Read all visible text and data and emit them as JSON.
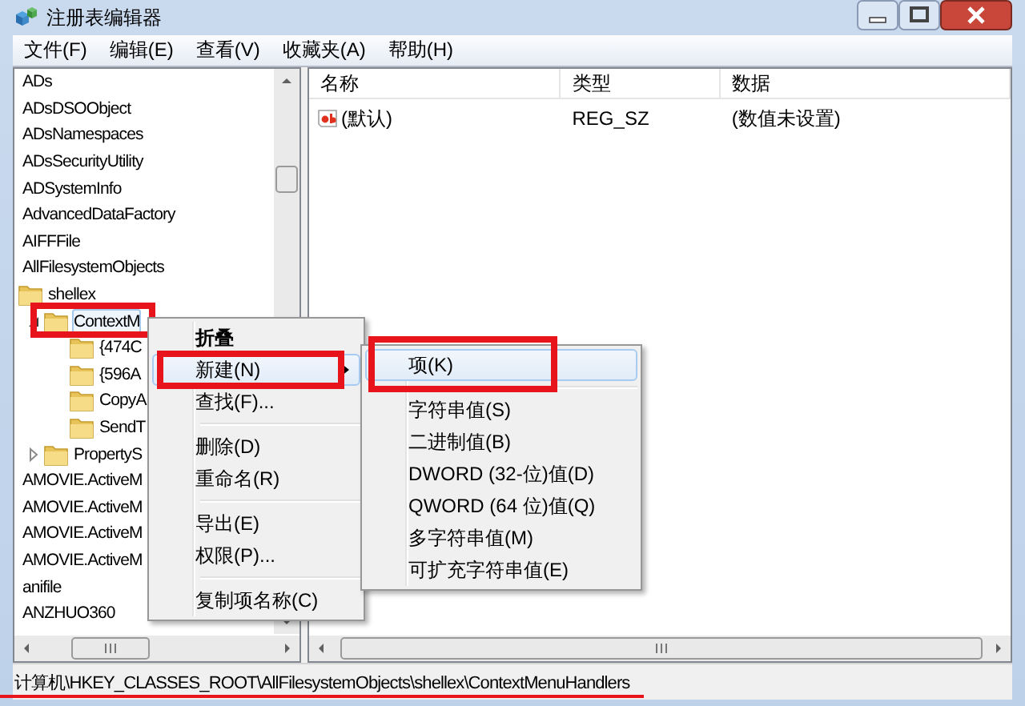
{
  "window": {
    "title": "注册表编辑器"
  },
  "menu_bar": [
    "文件(F)",
    "编辑(E)",
    "查看(V)",
    "收藏夹(A)",
    "帮助(H)"
  ],
  "tree": [
    {
      "label": "ADs",
      "selected": false
    },
    {
      "label": "ADsDSOObject",
      "selected": false
    },
    {
      "label": "ADsNamespaces",
      "selected": false
    },
    {
      "label": "ADsSecurityUtility",
      "selected": false
    },
    {
      "label": "ADSystemInfo",
      "selected": false
    },
    {
      "label": "AdvancedDataFactory",
      "selected": false
    },
    {
      "label": "AIFFFile",
      "selected": false
    },
    {
      "label": "AllFilesystemObjects",
      "selected": false,
      "children": [
        {
          "label": "shellex",
          "selected": false,
          "expanded": true,
          "children": [
            {
              "label": "ContextM",
              "selected": true,
              "expanded": true,
              "annotated": true,
              "children": [
                {
                  "label": "{474C",
                  "selected": false
                },
                {
                  "label": "{596A",
                  "selected": false
                },
                {
                  "label": "CopyA",
                  "selected": false
                },
                {
                  "label": "SendT",
                  "selected": false
                }
              ]
            },
            {
              "label": "PropertyS",
              "selected": false,
              "expanded": false
            }
          ]
        }
      ]
    },
    {
      "label": "AMOVIE.ActiveM",
      "selected": false
    },
    {
      "label": "AMOVIE.ActiveM",
      "selected": false
    },
    {
      "label": "AMOVIE.ActiveM",
      "selected": false
    },
    {
      "label": "AMOVIE.ActiveM",
      "selected": false
    },
    {
      "label": "anifile",
      "selected": false
    },
    {
      "label": "ANZHUO360",
      "selected": false
    }
  ],
  "list": {
    "columns": [
      "名称",
      "类型",
      "数据"
    ],
    "rows": [
      {
        "name": "(默认)",
        "type": "REG_SZ",
        "data": "(数值未设置)"
      }
    ]
  },
  "context_menu": {
    "items": [
      {
        "kind": "item",
        "label": "折叠",
        "bold": true,
        "selected": false
      },
      {
        "kind": "item",
        "label": "新建(N)",
        "selected": true,
        "submenu": true,
        "annotated": true
      },
      {
        "kind": "item",
        "label": "查找(F)...",
        "selected": false
      },
      {
        "kind": "separator"
      },
      {
        "kind": "item",
        "label": "删除(D)",
        "selected": false
      },
      {
        "kind": "item",
        "label": "重命名(R)",
        "selected": false
      },
      {
        "kind": "separator"
      },
      {
        "kind": "item",
        "label": "导出(E)",
        "selected": false
      },
      {
        "kind": "item",
        "label": "权限(P)...",
        "selected": false
      },
      {
        "kind": "separator"
      },
      {
        "kind": "item",
        "label": "复制项名称(C)",
        "selected": false
      }
    ]
  },
  "submenu": {
    "items": [
      {
        "kind": "item",
        "label": "项(K)",
        "selected": true,
        "annotated": true
      },
      {
        "kind": "separator"
      },
      {
        "kind": "item",
        "label": "字符串值(S)",
        "selected": false
      },
      {
        "kind": "item",
        "label": "二进制值(B)",
        "selected": false
      },
      {
        "kind": "item",
        "label": "DWORD (32-位)值(D)",
        "selected": false
      },
      {
        "kind": "item",
        "label": "QWORD (64 位)值(Q)",
        "selected": false
      },
      {
        "kind": "item",
        "label": "多字符串值(M)",
        "selected": false
      },
      {
        "kind": "item",
        "label": "可扩充字符串值(E)",
        "selected": false
      }
    ]
  },
  "status_bar": {
    "path": "计算机\\HKEY_CLASSES_ROOT\\AllFilesystemObjects\\shellex\\ContextMenuHandlers",
    "annotated": true
  }
}
